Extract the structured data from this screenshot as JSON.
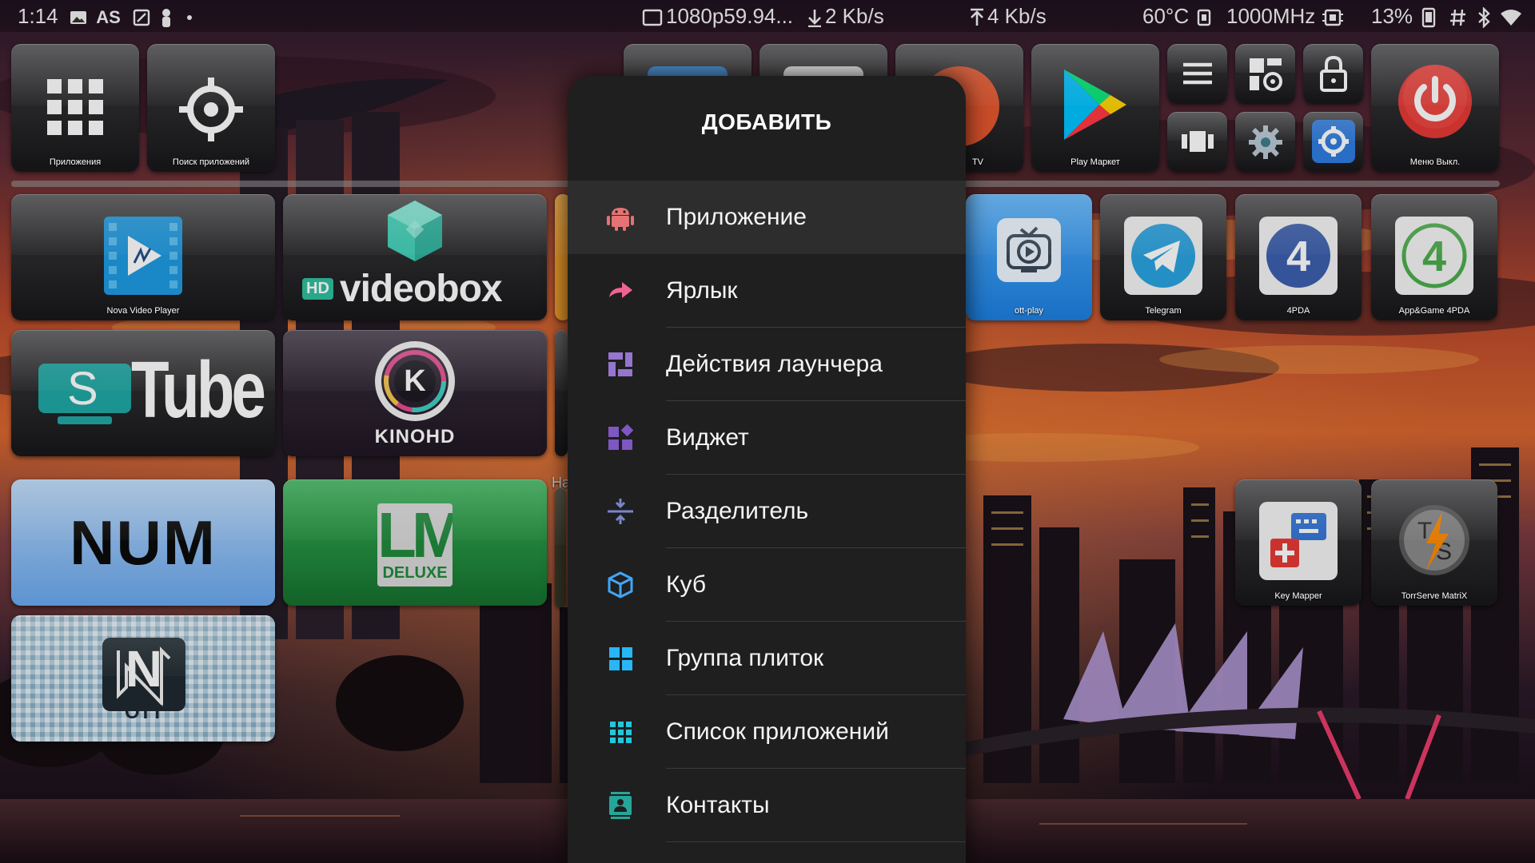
{
  "status_bar": {
    "time": "1:14",
    "left_icons": [
      "image-icon",
      "font-as-icon",
      "screen-cast-icon",
      "person-icon",
      "dot-icon"
    ],
    "resolution": "1080p59.94...",
    "download": "2 Kb/s",
    "upload": "4 Kb/s",
    "temperature": "60°C",
    "cpu_freq": "1000MHz",
    "cpu_load": "13%",
    "right_icons": [
      "chip-icon",
      "cpu-icon",
      "phone-icon",
      "hash-icon",
      "bluetooth-icon",
      "wifi-icon"
    ]
  },
  "launcher": {
    "top_row": [
      {
        "label": "Приложения",
        "icon": "app-grid-icon"
      },
      {
        "label": "Поиск приложений",
        "icon": "crosshair-icon"
      },
      {
        "label": "TV",
        "icon": "tv-partial-icon"
      },
      {
        "label": "Play Маркет",
        "icon": "play-store-icon"
      },
      {
        "label": "Меню Выкл.",
        "icon": "power-icon"
      }
    ],
    "quick_buttons": [
      "menu-icon",
      "widget-settings-icon",
      "lock-icon",
      "carousel-icon",
      "gear-icon",
      "settings-blue-icon"
    ],
    "tiles": [
      {
        "label": "Nova Video Player",
        "icon": "nova-video-icon"
      },
      {
        "label": "videobox",
        "badge": "HD",
        "icon": "videobox-cube-icon"
      },
      {
        "label": "ott-play",
        "icon": "ott-play-icon"
      },
      {
        "label": "Telegram",
        "icon": "telegram-icon"
      },
      {
        "label": "4PDA",
        "icon": "4pda-icon"
      },
      {
        "label": "App&Game 4PDA",
        "icon": "app-game-4pda-icon"
      },
      {
        "label": "Tube",
        "badge": "S",
        "icon": "stube-icon"
      },
      {
        "label": "KINOHD",
        "badge": "K",
        "icon": "kinohd-icon"
      },
      {
        "label": "NUM",
        "icon": "num-icon"
      },
      {
        "label": "LM",
        "badge": "DELUXE",
        "icon": "lm-deluxe-icon"
      },
      {
        "label": "OTT",
        "badge": "N",
        "icon": "ott-navigator-icon"
      },
      {
        "label": "Key Mapper",
        "icon": "key-mapper-icon"
      },
      {
        "label": "TorrServe MatriX",
        "icon": "torrserve-icon"
      }
    ],
    "partial_text": "На"
  },
  "menu": {
    "title": "ДОБАВИТЬ",
    "items": [
      {
        "label": "Приложение",
        "icon": "android-icon",
        "color": "#e57373",
        "selected": true
      },
      {
        "label": "Ярлык",
        "icon": "shortcut-arrow-icon",
        "color": "#f06292"
      },
      {
        "label": "Действия лаунчера",
        "icon": "launcher-actions-icon",
        "color": "#9575cd"
      },
      {
        "label": "Виджет",
        "icon": "widget-icon",
        "color": "#7e57c2"
      },
      {
        "label": "Разделитель",
        "icon": "divider-icon",
        "color": "#7986cb"
      },
      {
        "label": "Куб",
        "icon": "cube-icon",
        "color": "#42a5f5"
      },
      {
        "label": "Группа плиток",
        "icon": "tile-group-icon",
        "color": "#29b6f6"
      },
      {
        "label": "Список приложений",
        "icon": "app-list-icon",
        "color": "#26c6da"
      },
      {
        "label": "Контакты",
        "icon": "contacts-icon",
        "color": "#26a69a"
      }
    ]
  },
  "colors": {
    "menu_bg": "#1f1f1f",
    "menu_selected": "#2d2d2d",
    "ott_play_tile": "#2196f3",
    "num_tile": "#90c2f5",
    "lm_tile": "#1e8e3e",
    "power_red": "#e53935",
    "settings_blue": "#2f7de1"
  }
}
